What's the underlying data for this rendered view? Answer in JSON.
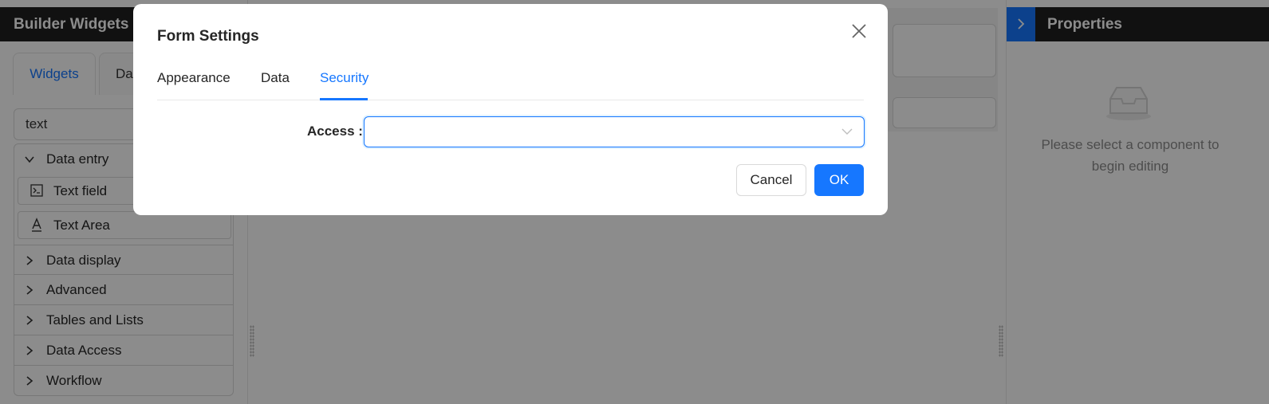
{
  "left_panel": {
    "title": "Builder Widgets",
    "tabs": [
      {
        "label": "Widgets",
        "active": true
      },
      {
        "label": "Dat",
        "active": false
      }
    ],
    "search_value": "text",
    "categories": [
      {
        "label": "Data entry",
        "expanded": true,
        "items": [
          {
            "label": "Text field",
            "icon": "terminal-icon"
          },
          {
            "label": "Text Area",
            "icon": "text-underline-icon"
          }
        ]
      },
      {
        "label": "Data display",
        "expanded": false
      },
      {
        "label": "Advanced",
        "expanded": false
      },
      {
        "label": "Tables and Lists",
        "expanded": false
      },
      {
        "label": "Data Access",
        "expanded": false
      },
      {
        "label": "Workflow",
        "expanded": false
      }
    ]
  },
  "right_panel": {
    "title": "Properties",
    "empty_text": "Please select a component to begin editing"
  },
  "modal": {
    "title": "Form Settings",
    "tabs": [
      {
        "label": "Appearance",
        "active": false
      },
      {
        "label": "Data",
        "active": false
      },
      {
        "label": "Security",
        "active": true
      }
    ],
    "access_label": "Access",
    "access_value": "",
    "cancel_label": "Cancel",
    "ok_label": "OK"
  },
  "colors": {
    "accent": "#1677ff",
    "header_bg": "#1f1f1f",
    "mask": "rgba(0,0,0,0.45)"
  }
}
